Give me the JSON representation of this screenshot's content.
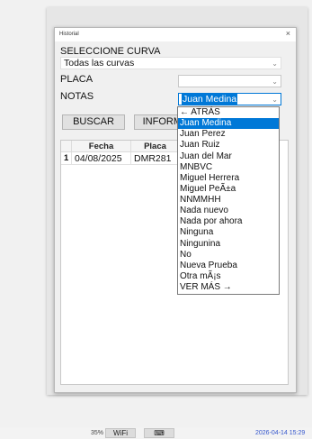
{
  "window": {
    "title": "Historial",
    "close_glyph": "×"
  },
  "form": {
    "curva_label": "SELECCIONE CURVA",
    "curva_value": "Todas las curvas",
    "placa_label": "PLACA",
    "placa_value": "",
    "notas_label": "NOTAS",
    "notas_value": "Juan Medina",
    "combo_arrow": "⌄"
  },
  "buttons": {
    "buscar": "BUSCAR",
    "informe": "INFORME"
  },
  "table": {
    "headers": [
      "",
      "Fecha",
      "Placa"
    ],
    "rows": [
      {
        "n": "1",
        "fecha": "04/08/2025",
        "placa": "DMR281"
      }
    ]
  },
  "dropdown": {
    "selected": "Juan Medina",
    "items": [
      "← ATRÁS",
      "Juan Medina",
      "Juan Perez",
      "Juan Ruiz",
      "Juan del Mar",
      "MNBVC",
      "Miguel Herrera",
      "Miguel PeÃ±a",
      "NNMMHH",
      "Nada nuevo",
      "Nada por ahora",
      "Ninguna",
      "Ningunina",
      "No",
      "Nueva Prueba",
      "Otra mÃ¡s",
      "VER MÁS →"
    ]
  },
  "taskbar": {
    "battery": "35%",
    "wifi": "WiFi",
    "keyboard": "⌨",
    "datetime": "2026-04-14 15:29"
  }
}
